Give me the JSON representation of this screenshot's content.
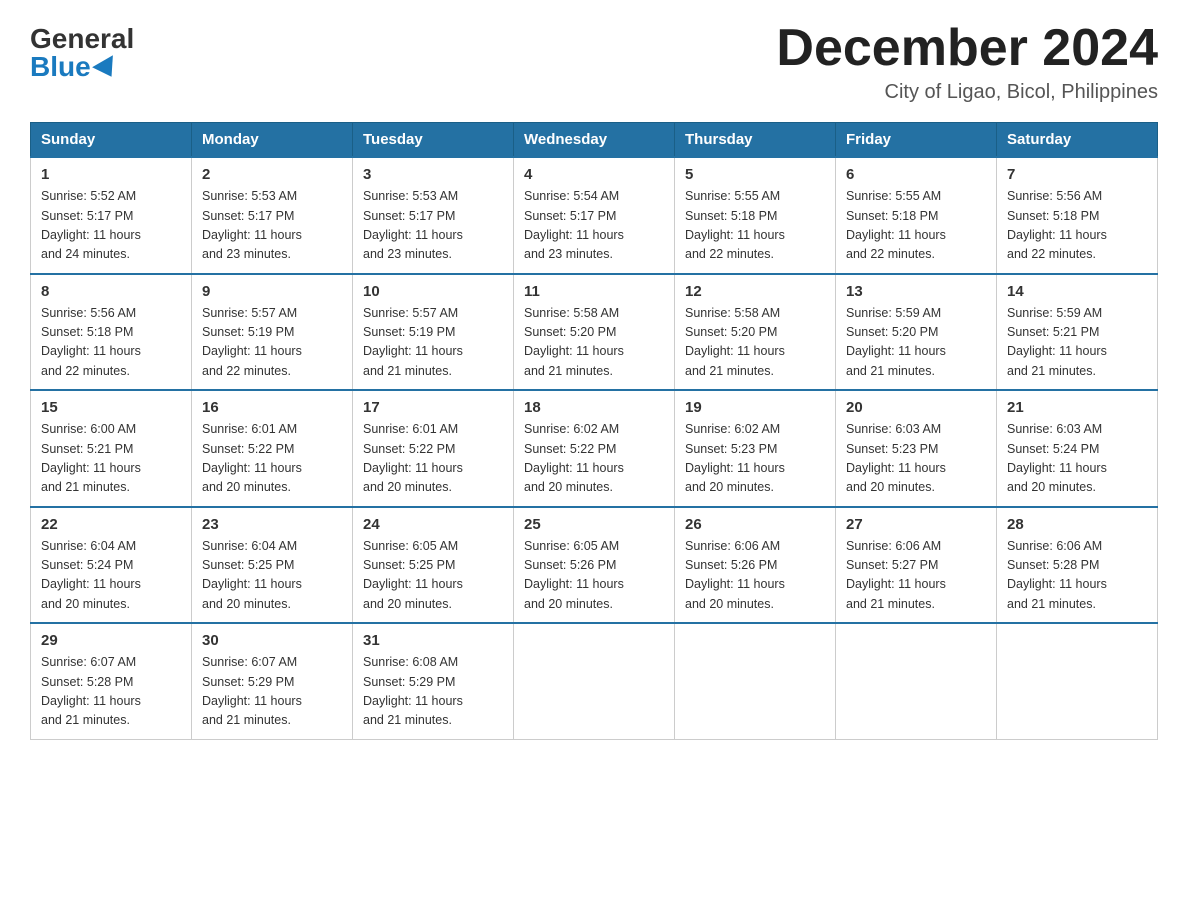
{
  "logo": {
    "general": "General",
    "blue": "Blue"
  },
  "header": {
    "month": "December 2024",
    "location": "City of Ligao, Bicol, Philippines"
  },
  "days_of_week": [
    "Sunday",
    "Monday",
    "Tuesday",
    "Wednesday",
    "Thursday",
    "Friday",
    "Saturday"
  ],
  "weeks": [
    [
      {
        "day": "1",
        "sunrise": "5:52 AM",
        "sunset": "5:17 PM",
        "daylight": "11 hours and 24 minutes."
      },
      {
        "day": "2",
        "sunrise": "5:53 AM",
        "sunset": "5:17 PM",
        "daylight": "11 hours and 23 minutes."
      },
      {
        "day": "3",
        "sunrise": "5:53 AM",
        "sunset": "5:17 PM",
        "daylight": "11 hours and 23 minutes."
      },
      {
        "day": "4",
        "sunrise": "5:54 AM",
        "sunset": "5:17 PM",
        "daylight": "11 hours and 23 minutes."
      },
      {
        "day": "5",
        "sunrise": "5:55 AM",
        "sunset": "5:18 PM",
        "daylight": "11 hours and 22 minutes."
      },
      {
        "day": "6",
        "sunrise": "5:55 AM",
        "sunset": "5:18 PM",
        "daylight": "11 hours and 22 minutes."
      },
      {
        "day": "7",
        "sunrise": "5:56 AM",
        "sunset": "5:18 PM",
        "daylight": "11 hours and 22 minutes."
      }
    ],
    [
      {
        "day": "8",
        "sunrise": "5:56 AM",
        "sunset": "5:18 PM",
        "daylight": "11 hours and 22 minutes."
      },
      {
        "day": "9",
        "sunrise": "5:57 AM",
        "sunset": "5:19 PM",
        "daylight": "11 hours and 22 minutes."
      },
      {
        "day": "10",
        "sunrise": "5:57 AM",
        "sunset": "5:19 PM",
        "daylight": "11 hours and 21 minutes."
      },
      {
        "day": "11",
        "sunrise": "5:58 AM",
        "sunset": "5:20 PM",
        "daylight": "11 hours and 21 minutes."
      },
      {
        "day": "12",
        "sunrise": "5:58 AM",
        "sunset": "5:20 PM",
        "daylight": "11 hours and 21 minutes."
      },
      {
        "day": "13",
        "sunrise": "5:59 AM",
        "sunset": "5:20 PM",
        "daylight": "11 hours and 21 minutes."
      },
      {
        "day": "14",
        "sunrise": "5:59 AM",
        "sunset": "5:21 PM",
        "daylight": "11 hours and 21 minutes."
      }
    ],
    [
      {
        "day": "15",
        "sunrise": "6:00 AM",
        "sunset": "5:21 PM",
        "daylight": "11 hours and 21 minutes."
      },
      {
        "day": "16",
        "sunrise": "6:01 AM",
        "sunset": "5:22 PM",
        "daylight": "11 hours and 20 minutes."
      },
      {
        "day": "17",
        "sunrise": "6:01 AM",
        "sunset": "5:22 PM",
        "daylight": "11 hours and 20 minutes."
      },
      {
        "day": "18",
        "sunrise": "6:02 AM",
        "sunset": "5:22 PM",
        "daylight": "11 hours and 20 minutes."
      },
      {
        "day": "19",
        "sunrise": "6:02 AM",
        "sunset": "5:23 PM",
        "daylight": "11 hours and 20 minutes."
      },
      {
        "day": "20",
        "sunrise": "6:03 AM",
        "sunset": "5:23 PM",
        "daylight": "11 hours and 20 minutes."
      },
      {
        "day": "21",
        "sunrise": "6:03 AM",
        "sunset": "5:24 PM",
        "daylight": "11 hours and 20 minutes."
      }
    ],
    [
      {
        "day": "22",
        "sunrise": "6:04 AM",
        "sunset": "5:24 PM",
        "daylight": "11 hours and 20 minutes."
      },
      {
        "day": "23",
        "sunrise": "6:04 AM",
        "sunset": "5:25 PM",
        "daylight": "11 hours and 20 minutes."
      },
      {
        "day": "24",
        "sunrise": "6:05 AM",
        "sunset": "5:25 PM",
        "daylight": "11 hours and 20 minutes."
      },
      {
        "day": "25",
        "sunrise": "6:05 AM",
        "sunset": "5:26 PM",
        "daylight": "11 hours and 20 minutes."
      },
      {
        "day": "26",
        "sunrise": "6:06 AM",
        "sunset": "5:26 PM",
        "daylight": "11 hours and 20 minutes."
      },
      {
        "day": "27",
        "sunrise": "6:06 AM",
        "sunset": "5:27 PM",
        "daylight": "11 hours and 21 minutes."
      },
      {
        "day": "28",
        "sunrise": "6:06 AM",
        "sunset": "5:28 PM",
        "daylight": "11 hours and 21 minutes."
      }
    ],
    [
      {
        "day": "29",
        "sunrise": "6:07 AM",
        "sunset": "5:28 PM",
        "daylight": "11 hours and 21 minutes."
      },
      {
        "day": "30",
        "sunrise": "6:07 AM",
        "sunset": "5:29 PM",
        "daylight": "11 hours and 21 minutes."
      },
      {
        "day": "31",
        "sunrise": "6:08 AM",
        "sunset": "5:29 PM",
        "daylight": "11 hours and 21 minutes."
      },
      null,
      null,
      null,
      null
    ]
  ],
  "labels": {
    "sunrise": "Sunrise:",
    "sunset": "Sunset:",
    "daylight": "Daylight:"
  }
}
